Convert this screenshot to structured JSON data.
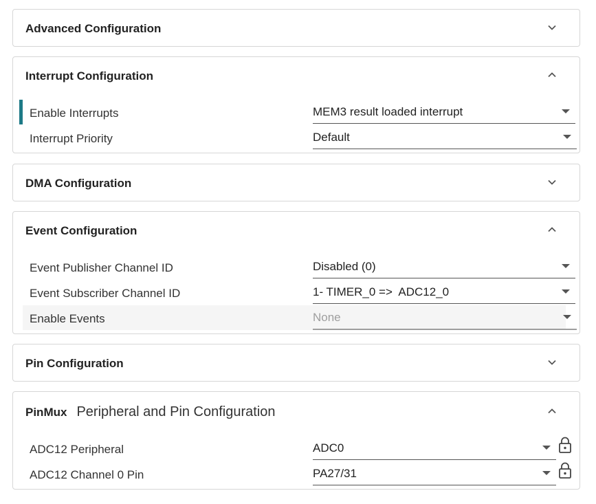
{
  "sections": {
    "advanced": {
      "title": "Advanced Configuration",
      "chevron": "chevron-down-icon"
    },
    "interrupt": {
      "title": "Interrupt Configuration",
      "chevron": "chevron-up-icon",
      "rows": [
        {
          "label": "Enable Interrupts",
          "value": "MEM3 result loaded interrupt"
        },
        {
          "label": "Interrupt Priority",
          "value": "Default"
        }
      ]
    },
    "dma": {
      "title": "DMA Configuration",
      "chevron": "chevron-down-icon"
    },
    "event": {
      "title": "Event Configuration",
      "chevron": "chevron-up-icon",
      "rows": [
        {
          "label": "Event Publisher Channel ID",
          "value": "Disabled (0)"
        },
        {
          "label": "Event Subscriber Channel ID",
          "value": "1- TIMER_0 =>  ADC12_0"
        },
        {
          "label": "Enable Events",
          "value": "None",
          "disabled": true
        }
      ]
    },
    "pin": {
      "title": "Pin Configuration",
      "chevron": "chevron-down-icon"
    },
    "pinmux": {
      "title": "PinMux",
      "subtitle": "Peripheral and Pin Configuration",
      "chevron": "chevron-up-icon",
      "rows": [
        {
          "label": "ADC12 Peripheral",
          "value": "ADC0",
          "icon": "lock-icon"
        },
        {
          "label": "ADC12 Channel 0 Pin",
          "value": "PA27/31",
          "icon": "lock-icon"
        }
      ]
    }
  },
  "colors": {
    "accent": "#1e7a87",
    "border": "#d6d6d6",
    "disabled_text": "#9e9e9e"
  }
}
